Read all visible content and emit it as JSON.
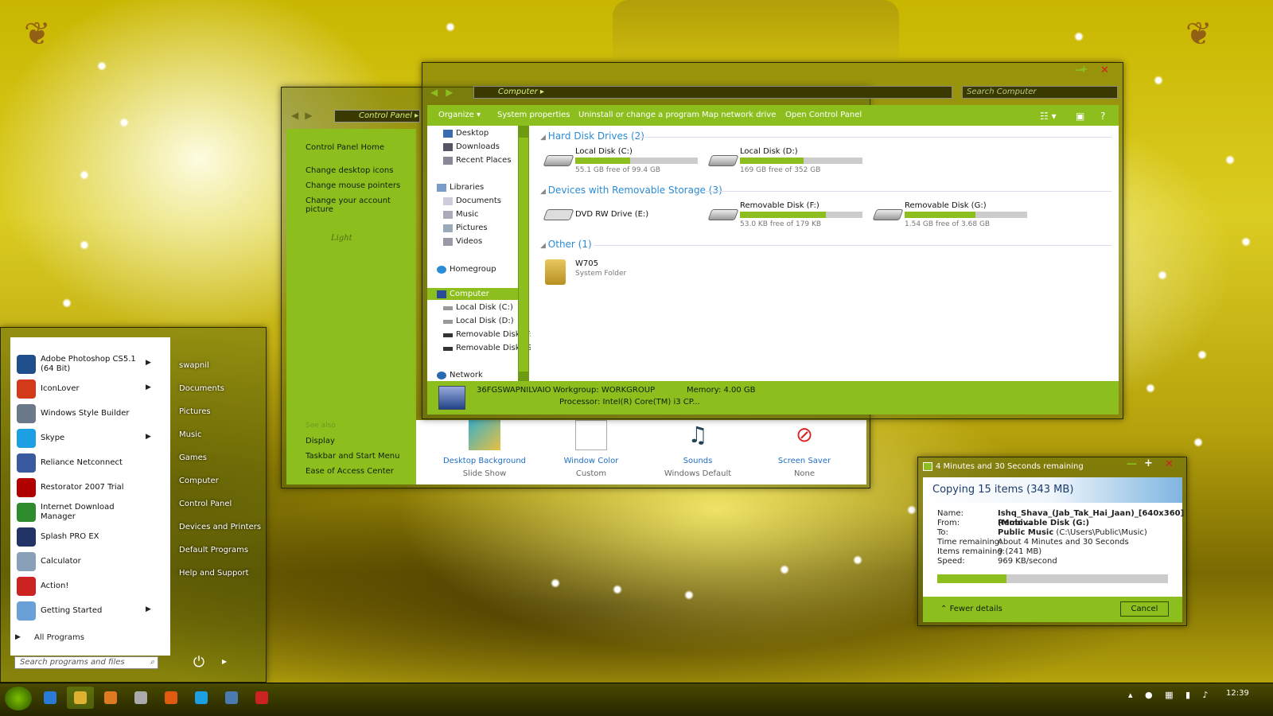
{
  "colors": {
    "accent": "#8cbe1e",
    "link": "#1f6fc5",
    "section": "#2a8bd6"
  },
  "control_panel": {
    "address": "Control Panel",
    "side_links": [
      "Control Panel Home",
      "Change desktop icons",
      "Change mouse pointers",
      "Change your account picture"
    ],
    "watermark": "Light",
    "see_also": "See also",
    "see_also_links": [
      "Display",
      "Taskbar and Start Menu",
      "Ease of Access Center"
    ],
    "items": [
      {
        "title": "Desktop Background",
        "sub": "Slide Show",
        "icon": "desktop-background-icon"
      },
      {
        "title": "Window Color",
        "sub": "Custom",
        "icon": "window-color-icon"
      },
      {
        "title": "Sounds",
        "sub": "Windows Default",
        "icon": "sounds-icon"
      },
      {
        "title": "Screen Saver",
        "sub": "None",
        "icon": "screen-saver-icon"
      }
    ]
  },
  "explorer": {
    "address": "Computer",
    "search_placeholder": "Search Computer",
    "window_controls": {
      "minimize": "—",
      "maximize": "+",
      "close": "✕"
    },
    "toolbar": [
      "Organize ▾",
      "System properties",
      "Uninstall or change a program",
      "Map network drive",
      "Open Control Panel"
    ],
    "nav": {
      "favorites": [
        "Desktop",
        "Downloads",
        "Recent Places"
      ],
      "libraries_title": "Libraries",
      "libraries": [
        "Documents",
        "Music",
        "Pictures",
        "Videos"
      ],
      "homegroup": "Homegroup",
      "computer": "Computer",
      "computer_items": [
        "Local Disk (C:)",
        "Local Disk (D:)",
        "Removable Disk (F:)",
        "Removable Disk (G:)"
      ],
      "network": "Network"
    },
    "sections": {
      "hard_disks": "Hard Disk Drives (2)",
      "removable": "Devices with Removable Storage (3)",
      "other": "Other (1)"
    },
    "hard_disks": [
      {
        "name": "Local Disk (C:)",
        "detail": "55.1 GB free of 99.4 GB",
        "used_fraction": 0.45
      },
      {
        "name": "Local Disk (D:)",
        "detail": "169 GB free of 352 GB",
        "used_fraction": 0.52
      }
    ],
    "removable": [
      {
        "name": "DVD RW Drive (E:)",
        "detail": "",
        "used_fraction": null
      },
      {
        "name": "Removable Disk (F:)",
        "detail": "53.0 KB free of 179 KB",
        "used_fraction": 0.7
      },
      {
        "name": "Removable Disk (G:)",
        "detail": "1.54 GB free of 3.68 GB",
        "used_fraction": 0.58
      }
    ],
    "other": {
      "name": "W705",
      "sub": "System Folder"
    },
    "status": {
      "computer_name": "36FGSWAPNILVAIO",
      "workgroup": "Workgroup:  WORKGROUP",
      "memory": "Memory:  4.00 GB",
      "processor": "Processor:  Intel(R) Core(TM) i3 CP..."
    }
  },
  "start_menu": {
    "programs": [
      {
        "name": "Adobe Photoshop CS5.1 (64 Bit)",
        "arrow": true,
        "icon": "photoshop-icon",
        "color": "#1e4f8c"
      },
      {
        "name": "IconLover",
        "arrow": true,
        "icon": "iconlover-icon",
        "color": "#d23a1a"
      },
      {
        "name": "Windows Style Builder",
        "arrow": false,
        "icon": "style-builder-icon",
        "color": "#6a7a8a"
      },
      {
        "name": "Skype",
        "arrow": true,
        "icon": "skype-icon",
        "color": "#1ca0e3"
      },
      {
        "name": "Reliance Netconnect",
        "arrow": false,
        "icon": "netconnect-icon",
        "color": "#3a5aa0"
      },
      {
        "name": "Restorator 2007 Trial",
        "arrow": false,
        "icon": "restorator-icon",
        "color": "#b00000"
      },
      {
        "name": "Internet Download Manager",
        "arrow": false,
        "icon": "idm-icon",
        "color": "#2e8b2e"
      },
      {
        "name": "Splash PRO EX",
        "arrow": false,
        "icon": "splash-icon",
        "color": "#223366"
      },
      {
        "name": "Calculator",
        "arrow": false,
        "icon": "calculator-icon",
        "color": "#8aa0b8"
      },
      {
        "name": "Action!",
        "arrow": false,
        "icon": "action-icon",
        "color": "#cc2222"
      },
      {
        "name": "Getting Started",
        "arrow": true,
        "icon": "getting-started-icon",
        "color": "#6aa0d8"
      }
    ],
    "all_programs": "All Programs",
    "search_placeholder": "Search programs and files",
    "right_items": [
      "swapnil",
      "Documents",
      "Pictures",
      "Music",
      "Games",
      "Computer",
      "Control Panel",
      "Devices and Printers",
      "Default Programs",
      "Help and Support"
    ]
  },
  "copy_dialog": {
    "title": "4 Minutes and 30 Seconds remaining",
    "header": "Copying 15 items (343 MB)",
    "rows": [
      {
        "label": "Name:",
        "value": "Ishq_Shava_(Jab_Tak_Hai_Jaan)_[640x360](Mobi...",
        "bold": true
      },
      {
        "label": "From:",
        "value": "Removable Disk (G:)",
        "bold": true
      },
      {
        "label": "To:",
        "value": "Public Music",
        "extra": " (C:\\Users\\Public\\Music)",
        "bold": true
      },
      {
        "label": "Time remaining:",
        "value": "About 4 Minutes and 30 Seconds",
        "bold": false
      },
      {
        "label": "Items remaining:",
        "value": "9 (241 MB)",
        "bold": false
      },
      {
        "label": "Speed:",
        "value": "969 KB/second",
        "bold": false
      }
    ],
    "progress": 0.3,
    "fewer_details": "Fewer details",
    "cancel": "Cancel"
  },
  "taskbar": {
    "clock": "12:39",
    "pinned": [
      "internet-explorer-icon",
      "explorer-icon",
      "media-player-icon",
      "settings-icon",
      "firefox-icon",
      "skype-icon",
      "display-icon",
      "action-icon"
    ]
  }
}
